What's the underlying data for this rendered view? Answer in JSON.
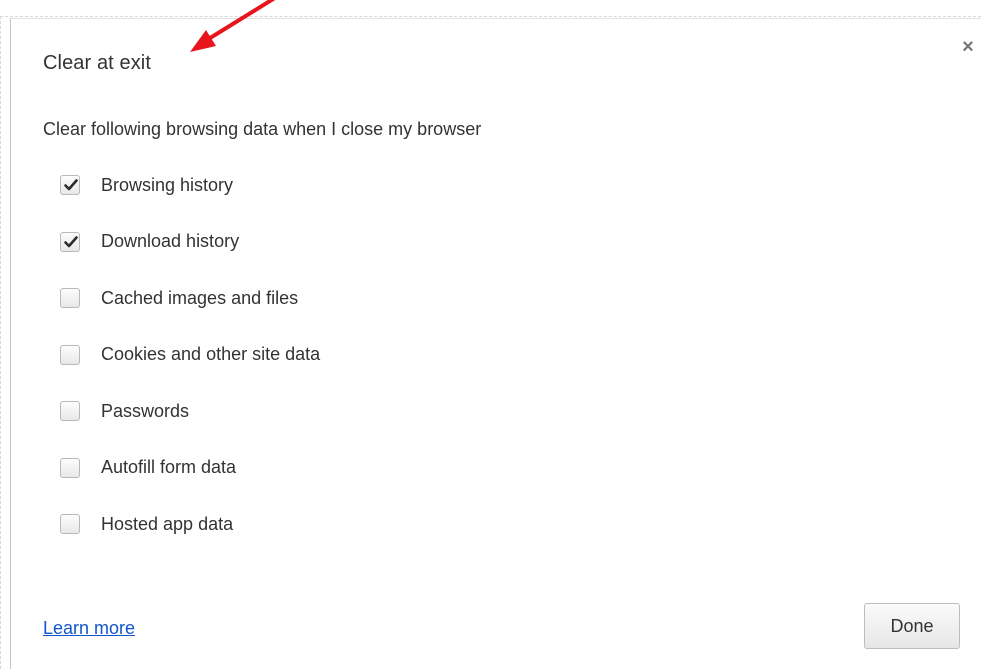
{
  "dialog": {
    "title": "Clear at exit",
    "close_icon": "close-icon",
    "description": "Clear following browsing data when I close my browser",
    "options": [
      {
        "label": "Browsing history",
        "checked": true
      },
      {
        "label": "Download history",
        "checked": true
      },
      {
        "label": "Cached images and files",
        "checked": false
      },
      {
        "label": "Cookies and other site data",
        "checked": false
      },
      {
        "label": "Passwords",
        "checked": false
      },
      {
        "label": "Autofill form data",
        "checked": false
      },
      {
        "label": "Hosted app data",
        "checked": false
      }
    ],
    "learn_more": "Learn more",
    "done_label": "Done"
  },
  "colors": {
    "link": "#1155cc",
    "annotation_arrow": "#e8161c",
    "text": "#333333"
  }
}
